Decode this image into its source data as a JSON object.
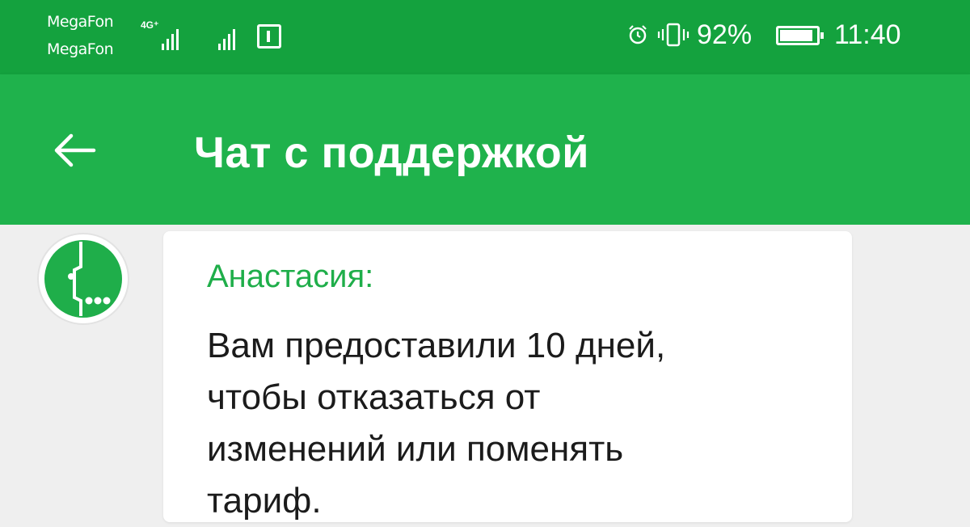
{
  "status_bar": {
    "carrier_1": "MegaFon",
    "carrier_2": "MegaFon",
    "network_type": "4G⁺",
    "battery_percent": "92%",
    "time": "11:40",
    "icons": [
      "signal-icon",
      "signal-icon",
      "sim-icon",
      "alarm-icon",
      "vibrate-icon",
      "battery-icon"
    ],
    "background_color": "#14a23e"
  },
  "header": {
    "back_icon": "arrow-left-icon",
    "title": "Чат с поддержкой",
    "background_color": "#1fb24c"
  },
  "chat": {
    "messages": [
      {
        "avatar_icon": "megafon-logo-icon",
        "sender": "Анастасия:",
        "text_lines": [
          "Вам предоставили 10 дней,",
          "чтобы отказаться от",
          "изменений или поменять",
          "тариф."
        ],
        "sender_color": "#1fae4a"
      }
    ]
  }
}
